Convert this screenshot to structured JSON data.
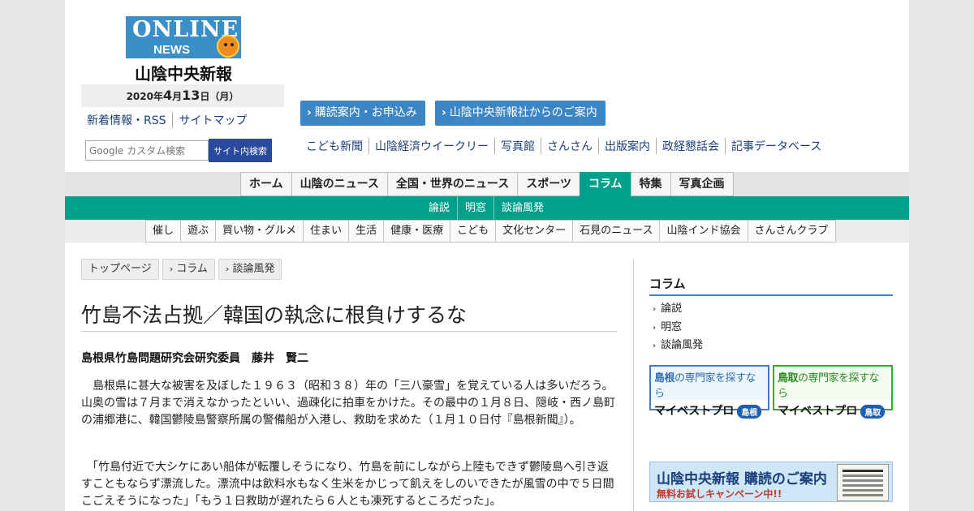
{
  "header": {
    "logo_online": "ONLINE",
    "logo_news": "NEWS",
    "logo_name": "山陰中央新報",
    "date_year": "2020年",
    "date_month": "4",
    "date_month_unit": "月",
    "date_day": "13",
    "date_day_unit": "日（月）",
    "links": [
      "新着情報・RSS",
      "サイトマップ"
    ],
    "search_placeholder": "Google カスタム検索",
    "search_button": "サイト内検索",
    "buttons": [
      "購読案内・お申込み",
      "山陰中央新報社からのご案内"
    ],
    "sublinks": [
      "こども新聞",
      "山陰経済ウイークリー",
      "写真館",
      "さんさん",
      "出版案内",
      "政経懇話会",
      "記事データベース"
    ]
  },
  "nav": {
    "main": [
      "ホーム",
      "山陰のニュース",
      "全国・世界のニュース",
      "スポーツ",
      "コラム",
      "特集",
      "写真企画"
    ],
    "active": "コラム",
    "green": [
      "論説",
      "明窓",
      "談論風発"
    ],
    "sub": [
      "催し",
      "遊ぶ",
      "買い物・グルメ",
      "住まい",
      "生活",
      "健康・医療",
      "こども",
      "文化センター",
      "石見のニュース",
      "山陰インド協会",
      "さんさんクラブ"
    ]
  },
  "breadcrumb": [
    "トップページ",
    "コラム",
    "談論風発"
  ],
  "article": {
    "title": "竹島不法占拠／韓国の執念に根負けするな",
    "author": "島根県竹島問題研究会研究委員　藤井　賢二",
    "paragraphs": [
      "　島根県に甚大な被害を及ぼした１９６３（昭和３８）年の「三八豪雪」を覚えている人は多いだろう。山奥の雪は７月まで消えなかったといい、過疎化に拍車をかけた。その最中の１月８日、隠岐・西ノ島町の浦郷港に、韓国鬱陵島警察所属の警備船が入港し、救助を求めた（１月１０日付『島根新聞』）。",
      "　「竹島付近で大シケにあい船体が転覆しそうになり、竹島を前にしながら上陸もできず鬱陵島へ引き返すこともならず漂流した。漂流中は飲料水もなく生米をかじって飢えをしのいできたが風雪の中で５日間こごえそうになった」「もう１日救助が遅れたら６人とも凍死するところだった」。"
    ]
  },
  "sidebar": {
    "heading": "コラム",
    "items": [
      "論説",
      "明窓",
      "談論風発"
    ],
    "banner_shimane_top_a": "島根",
    "banner_shimane_top_b": "の専門家を探すなら",
    "banner_tottori_top_a": "鳥取",
    "banner_tottori_top_b": "の専門家を探すなら",
    "banner_brand": "マイベストプロ",
    "banner_shimane_pill": "島根",
    "banner_tottori_pill": "鳥取",
    "subscribe_title": "山陰中央新報 購読のご案内",
    "subscribe_sub": "無料お試しキャンペーン中!!"
  },
  "colors": {
    "accent_green": "#00a08a",
    "accent_blue": "#3d86c6",
    "link": "#1a3f7a"
  }
}
